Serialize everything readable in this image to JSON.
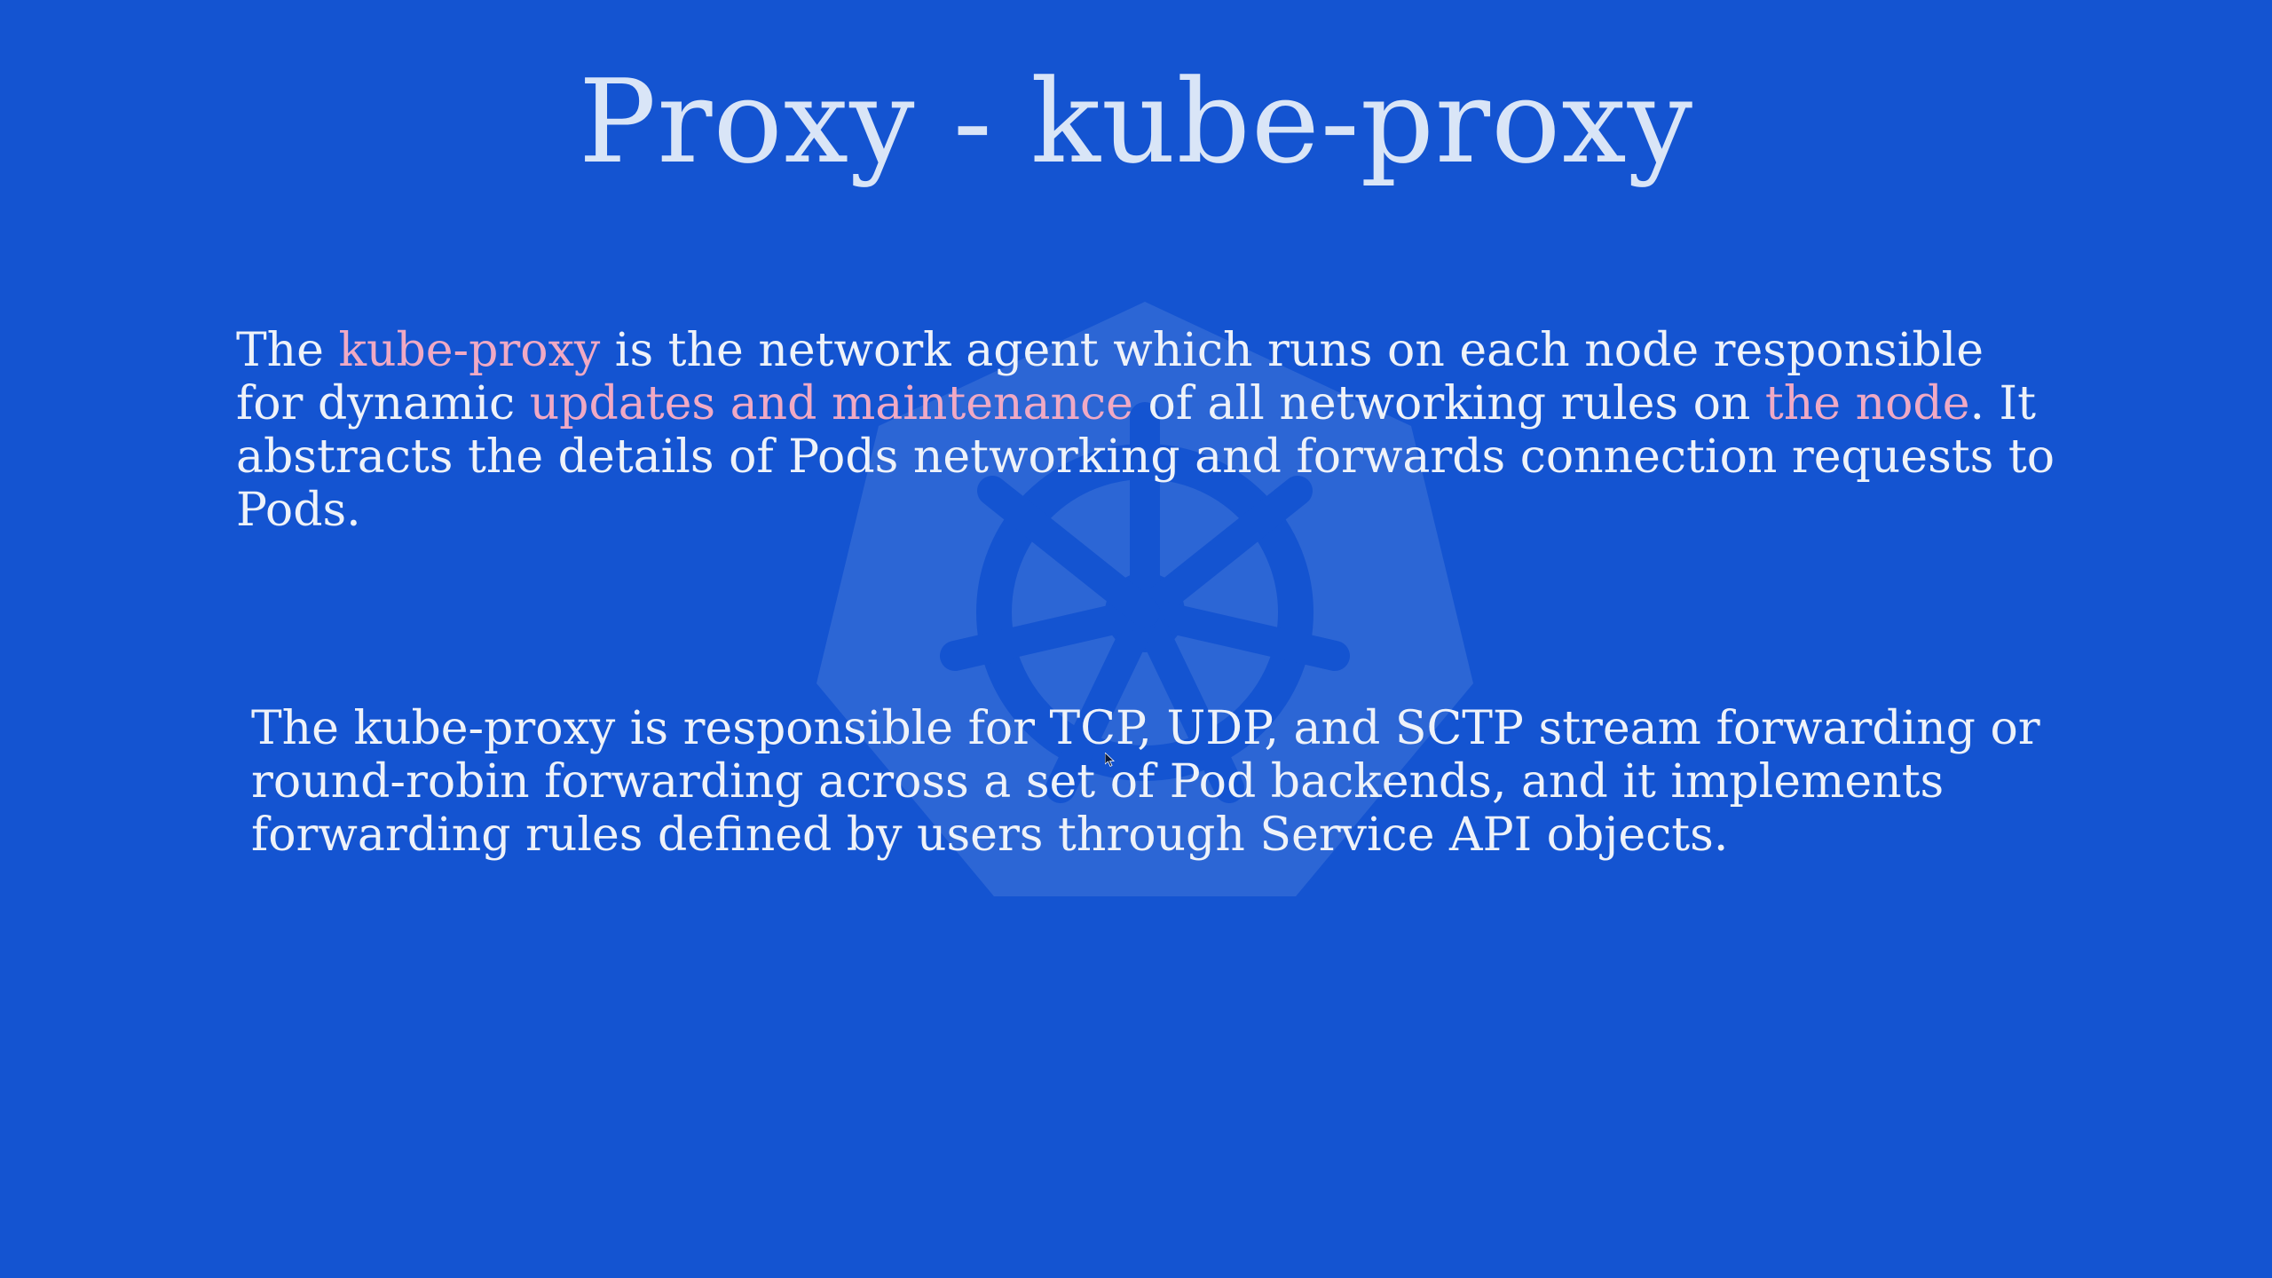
{
  "slide": {
    "title": "Proxy - kube-proxy",
    "paragraph1": {
      "t1": "The ",
      "h1": "kube-proxy",
      "t2": " is the network agent which runs on each node responsible for dynamic ",
      "h2": "updates and maintenance",
      "t3": " of all networking rules on ",
      "h3": "the node",
      "t4": ". It abstracts the details of Pods networking and forwards connection requests to Pods."
    },
    "paragraph2": "The kube-proxy is responsible for TCP, UDP, and SCTP stream forwarding or round-robin forwarding across a set of Pod backends, and it implements forwarding rules defined by users through Service API objects."
  },
  "colors": {
    "background": "#1454d1",
    "title": "#d9e5f7",
    "text": "#eef2f9",
    "highlight": "#f0a9c4"
  },
  "icons": {
    "watermark": "kubernetes-helm-logo-icon",
    "cursor": "mouse-pointer-icon"
  }
}
